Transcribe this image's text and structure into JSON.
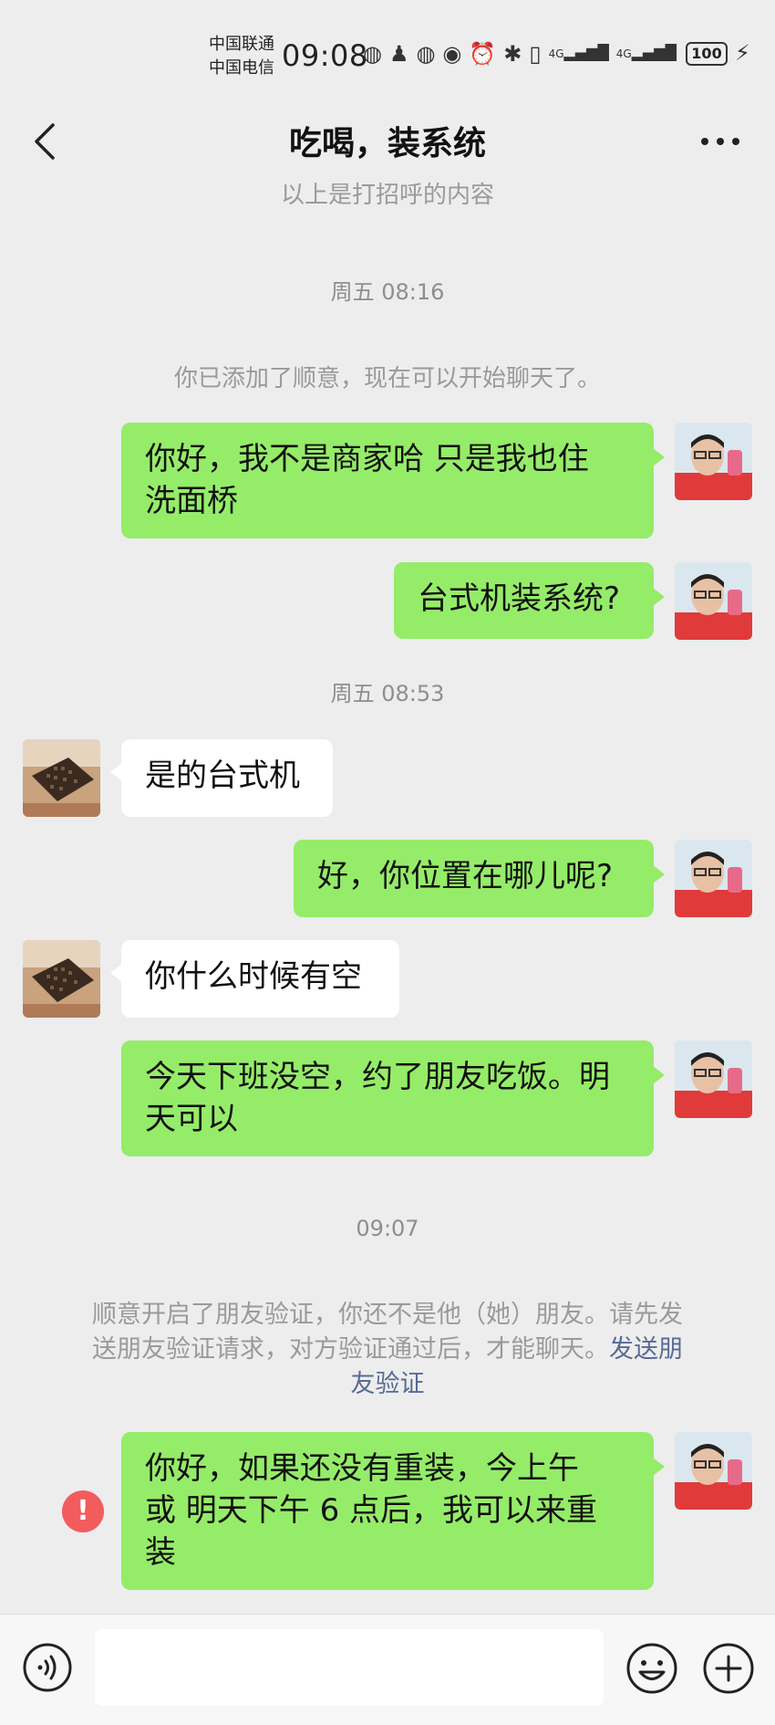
{
  "status_bar": {
    "carrier_1": "中国联通",
    "carrier_2": "中国电信",
    "time": "09:08",
    "network_1": "4G",
    "network_2": "4G",
    "battery": "100"
  },
  "header": {
    "title": "吃喝，装系统"
  },
  "messages": {
    "sys_top": "以上是打招呼的内容",
    "time_1": "周五 08:16",
    "sys_added": "你已添加了顺意，现在可以开始聊天了。",
    "me_1_line1": "你好，我不是商家哈  只是我也住",
    "me_1_line2": "洗面桥",
    "me_2": "台式机装系统?",
    "time_2": "周五 08:53",
    "them_1": "是的台式机",
    "me_3": "好，你位置在哪儿呢?",
    "them_2": "你什么时候有空",
    "me_4_line1": "今天下班没空，约了朋友吃饭。明",
    "me_4_line2": "天可以",
    "time_3": "09:07",
    "notice_line1": "顺意开启了朋友验证，你还不是他（她）朋友。请先发",
    "notice_line2": "送朋友验证请求，对方验证通过后，才能聊天。",
    "notice_link_part1": "发送朋",
    "notice_link_part2": "友验证",
    "me_5_line1": "你好，如果还没有重装，今上午",
    "me_5_line2": "或  明天下午 6 点后，我可以来重",
    "me_5_line3": "装",
    "error_mark": "!"
  },
  "input": {
    "placeholder": ""
  },
  "colors": {
    "background": "#ededed",
    "my_bubble": "#95ec69",
    "their_bubble": "#ffffff",
    "link": "#576b95",
    "error": "#f25c5c"
  },
  "icons": {
    "back": "chevron-left-icon",
    "more": "more-dots-icon",
    "voice": "voice-icon",
    "emoji": "emoji-icon",
    "plus": "plus-icon"
  }
}
